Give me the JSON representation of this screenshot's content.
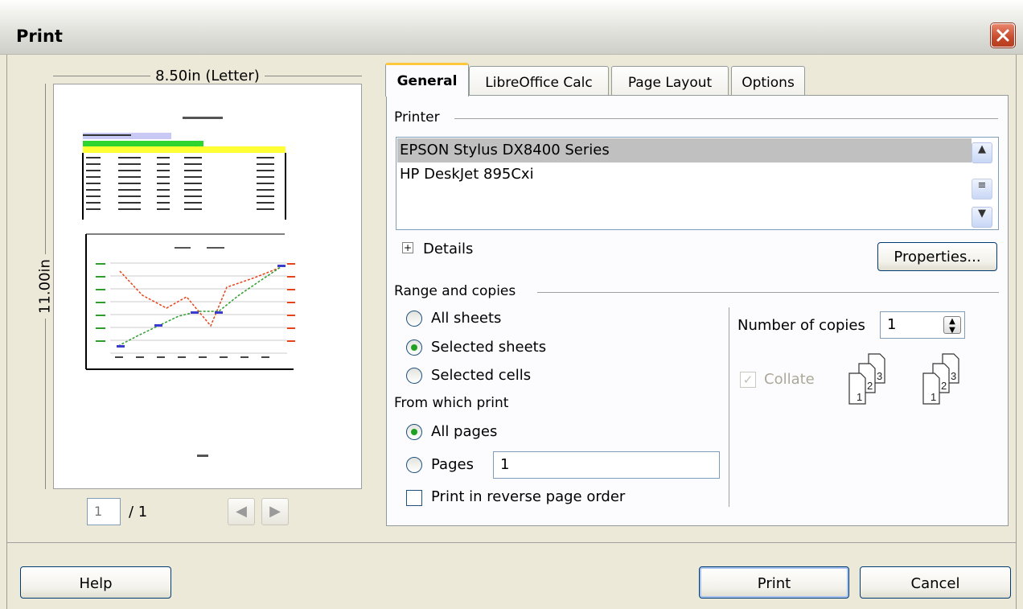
{
  "window": {
    "title": "Print"
  },
  "preview": {
    "paper_size": "8.50in (Letter)",
    "paper_height": "11.00in",
    "current_page": "1",
    "total_pages": "/ 1"
  },
  "tabs": [
    {
      "label": "General",
      "active": true
    },
    {
      "label": "LibreOffice Calc"
    },
    {
      "label": "Page Layout"
    },
    {
      "label": "Options"
    }
  ],
  "printer": {
    "section_label": "Printer",
    "items": [
      "EPSON Stylus DX8400 Series",
      "HP DeskJet 895Cxi"
    ],
    "selected_index": 0,
    "details_label": "Details",
    "properties_label": "Properties..."
  },
  "range": {
    "section_label": "Range and copies",
    "options": [
      {
        "label": "All sheets",
        "checked": false
      },
      {
        "label": "Selected sheets",
        "checked": true
      },
      {
        "label": "Selected cells",
        "checked": false
      }
    ],
    "from_which_label": "From which print",
    "page_options": [
      {
        "label": "All pages",
        "checked": true
      },
      {
        "label": "Pages",
        "checked": false
      }
    ],
    "pages_value": "1",
    "reverse_label": "Print in reverse page order"
  },
  "copies": {
    "label": "Number of copies",
    "value": "1",
    "collate_label": "Collate",
    "collate_checked": true
  },
  "buttons": {
    "help": "Help",
    "print": "Print",
    "cancel": "Cancel"
  }
}
